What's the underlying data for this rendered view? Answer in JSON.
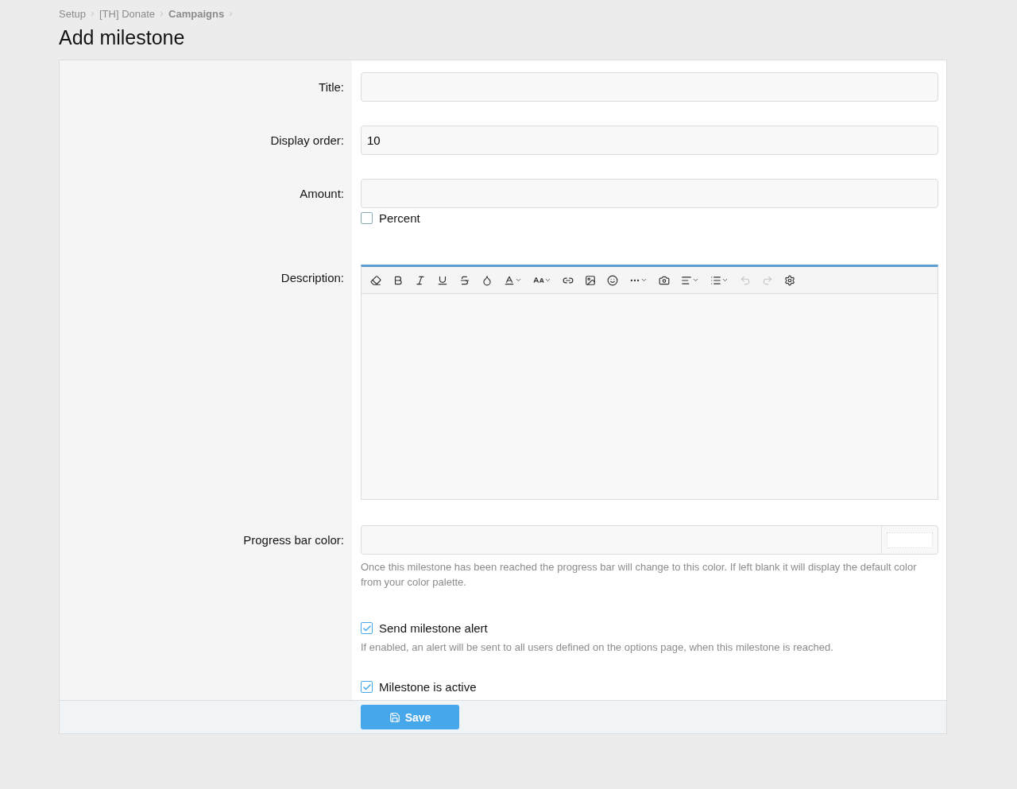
{
  "breadcrumb": [
    {
      "label": "Setup",
      "current": false
    },
    {
      "label": "[TH] Donate",
      "current": false
    },
    {
      "label": "Campaigns",
      "current": true
    }
  ],
  "page_title": "Add milestone",
  "form": {
    "rows": [
      {
        "kind": "text",
        "label": "Title:"
      },
      {
        "kind": "text",
        "label": "Display order:",
        "value": "10"
      },
      {
        "kind": "amount",
        "label": "Amount:",
        "checkbox": {
          "label": "Percent",
          "checked": false
        }
      },
      {
        "kind": "editor",
        "label": "Description:",
        "toolbar": [
          {
            "kind": "eraser",
            "disabled": false
          },
          {
            "kind": "bold",
            "disabled": false
          },
          {
            "kind": "italic",
            "disabled": false
          },
          {
            "kind": "underline",
            "disabled": false
          },
          {
            "kind": "strike",
            "disabled": false
          },
          {
            "kind": "drop",
            "disabled": false
          },
          {
            "kind": "font-color",
            "disabled": false
          },
          {
            "kind": "font-size",
            "disabled": false
          },
          {
            "kind": "link",
            "disabled": false
          },
          {
            "kind": "image",
            "disabled": false
          },
          {
            "kind": "smile",
            "disabled": false
          },
          {
            "kind": "more",
            "disabled": false
          },
          {
            "kind": "camera",
            "disabled": false
          },
          {
            "kind": "align",
            "disabled": false
          },
          {
            "kind": "list",
            "disabled": false
          },
          {
            "kind": "undo",
            "disabled": true
          },
          {
            "kind": "redo",
            "disabled": true
          },
          {
            "kind": "gear",
            "disabled": false
          }
        ]
      },
      {
        "kind": "color",
        "label": "Progress bar color:",
        "hint": "Once this milestone has been reached the progress bar will change to this color. If left blank it will display the default color from your color palette."
      },
      {
        "kind": "check",
        "checkbox": {
          "label": "Send milestone alert",
          "checked": true
        },
        "hint": "If enabled, an alert will be sent to all users defined on the options page, when this milestone is reached."
      },
      {
        "kind": "check",
        "checkbox": {
          "label": "Milestone is active",
          "checked": true
        }
      }
    ],
    "submit": "Save"
  }
}
